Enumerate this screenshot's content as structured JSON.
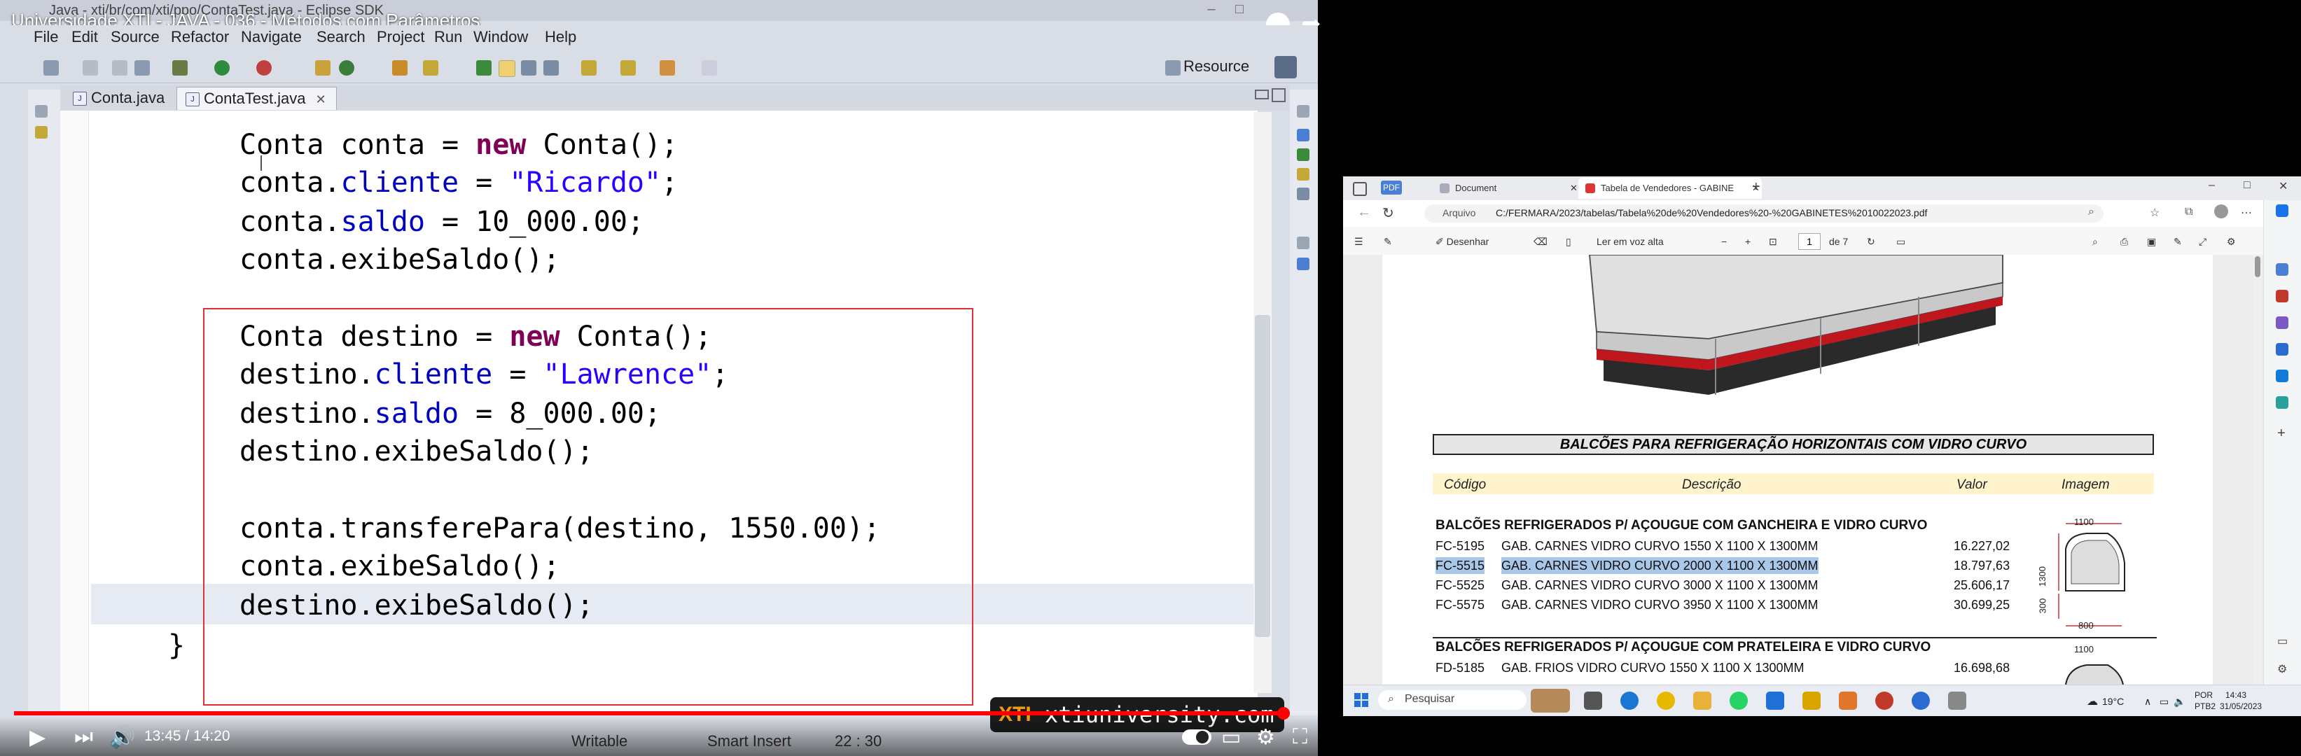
{
  "eclipse": {
    "window_title": "Java - xti/br/com/xti/ppo/ContaTest.java - Eclipse SDK",
    "menu": [
      "File",
      "Edit",
      "Source",
      "Refactor",
      "Navigate",
      "Search",
      "Project",
      "Run",
      "Window",
      "Help"
    ],
    "perspective": "Resource",
    "tabs": [
      {
        "label": "Conta.java",
        "active": false
      },
      {
        "label": "ContaTest.java",
        "active": true
      }
    ],
    "code_lines": [
      {
        "indent": "",
        "parts": [
          {
            "t": "Conta conta = ",
            "c": ""
          },
          {
            "t": "new",
            "c": "kw"
          },
          {
            "t": " Conta();",
            "c": ""
          }
        ]
      },
      {
        "indent": "",
        "parts": [
          {
            "t": "conta.",
            "c": ""
          },
          {
            "t": "cliente",
            "c": "fld"
          },
          {
            "t": " = ",
            "c": ""
          },
          {
            "t": "\"Ricardo\"",
            "c": "str"
          },
          {
            "t": ";",
            "c": ""
          }
        ]
      },
      {
        "indent": "",
        "parts": [
          {
            "t": "conta.",
            "c": ""
          },
          {
            "t": "saldo",
            "c": "fld"
          },
          {
            "t": " = 10_000.00;",
            "c": ""
          }
        ]
      },
      {
        "indent": "",
        "parts": [
          {
            "t": "conta.exibeSaldo();",
            "c": ""
          }
        ]
      },
      {
        "indent": "",
        "parts": [
          {
            "t": "",
            "c": ""
          }
        ]
      },
      {
        "indent": "",
        "parts": [
          {
            "t": "Conta destino = ",
            "c": ""
          },
          {
            "t": "new",
            "c": "kw"
          },
          {
            "t": " Conta();",
            "c": ""
          }
        ]
      },
      {
        "indent": "",
        "parts": [
          {
            "t": "destino.",
            "c": ""
          },
          {
            "t": "cliente",
            "c": "fld"
          },
          {
            "t": " = ",
            "c": ""
          },
          {
            "t": "\"Lawrence\"",
            "c": "str"
          },
          {
            "t": ";",
            "c": ""
          }
        ]
      },
      {
        "indent": "",
        "parts": [
          {
            "t": "destino.",
            "c": ""
          },
          {
            "t": "saldo",
            "c": "fld"
          },
          {
            "t": " = 8_000.00;",
            "c": ""
          }
        ]
      },
      {
        "indent": "",
        "parts": [
          {
            "t": "destino.exibeSaldo();",
            "c": ""
          }
        ]
      },
      {
        "indent": "",
        "parts": [
          {
            "t": "",
            "c": ""
          }
        ]
      },
      {
        "indent": "",
        "parts": [
          {
            "t": "conta.transferePara(destino, 1550.00);",
            "c": ""
          }
        ]
      },
      {
        "indent": "",
        "parts": [
          {
            "t": "conta.exibeSaldo();",
            "c": ""
          }
        ]
      },
      {
        "indent": "",
        "parts": [
          {
            "t": "destino.exibeSaldo();",
            "c": ""
          }
        ]
      }
    ],
    "closing_brace": "}",
    "status": {
      "writable": "Writable",
      "insert_mode": "Smart Insert",
      "position": "22 : 30"
    }
  },
  "youtube": {
    "video_title": "Universidade XTI - JAVA - 036 - Métodos com Parâmetros",
    "time": "13:45 / 14:20",
    "progress": 0.9735,
    "watermark": "xtiuniversity.com"
  },
  "edge": {
    "tabs": [
      {
        "label": "Document",
        "active": false
      },
      {
        "label": "Tabela de Vendedores - GABINE",
        "active": true
      }
    ],
    "pdf_badge": "PDF",
    "address_label": "Arquivo",
    "url": "C:/FERMARA/2023/tabelas/Tabela%20de%20Vendedores%20-%20GABINETES%2010022023.pdf",
    "toolbar": {
      "draw": "Desenhar",
      "read_aloud": "Ler em voz alta",
      "page": "1",
      "page_of": "de 7"
    }
  },
  "pdf": {
    "section_title": "BALCÕES PARA REFRIGERAÇÃO  HORIZONTAIS COM VIDRO CURVO",
    "headers": {
      "code": "Código",
      "desc": "Descrição",
      "value": "Valor",
      "image": "Imagem"
    },
    "group1_title": "BALCÕES REFRIGERADOS P/ AÇOUGUE COM GANCHEIRA E VIDRO CURVO",
    "group1": [
      {
        "code": "FC-5195",
        "desc": "GAB. CARNES VIDRO CURVO 1550 X 1100 X 1300MM",
        "value": "16.227,02",
        "selected": false
      },
      {
        "code": "FC-5515",
        "desc": "GAB. CARNES VIDRO CURVO 2000 X 1100 X 1300MM",
        "value": "18.797,63",
        "selected": true
      },
      {
        "code": "FC-5525",
        "desc": "GAB. CARNES VIDRO CURVO 3000 X 1100 X 1300MM",
        "value": "25.606,17",
        "selected": false
      },
      {
        "code": "FC-5575",
        "desc": "GAB. CARNES VIDRO CURVO 3950 X 1100 X 1300MM",
        "value": "30.699,25",
        "selected": false
      }
    ],
    "group2_title": "BALCÕES REFRIGERADOS P/ AÇOUGUE COM PRATELEIRA E VIDRO CURVO",
    "group2": [
      {
        "code": "FD-5185",
        "desc": "GAB. FRIOS VIDRO CURVO 1550 X 1100 X 1300MM",
        "value": "16.698,68",
        "selected": false
      }
    ],
    "dims": {
      "w1": "1100",
      "h": "1300",
      "h2": "300",
      "w2": "800",
      "w3": "1100"
    }
  },
  "taskbar": {
    "search": "Pesquisar",
    "weather": "19°C",
    "lang": "POR",
    "lang2": "PTB2",
    "clock": "14:43",
    "date": "31/05/2023"
  }
}
